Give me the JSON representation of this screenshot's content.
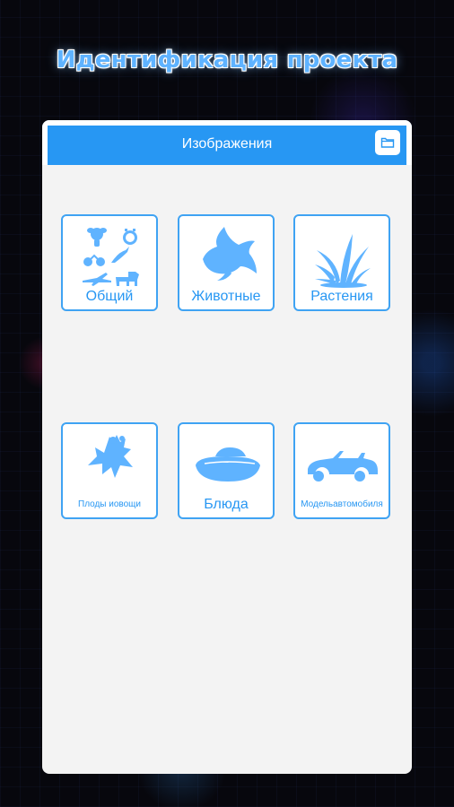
{
  "headline": "Идентификация проекта",
  "topbar": {
    "title": "Изображения",
    "folder_icon": "folder-icon"
  },
  "colors": {
    "accent": "#2797f3",
    "tile_border": "#3fa3f3",
    "panel_bg": "#f3f3f3"
  },
  "categories": [
    {
      "label": "Общий",
      "icon": "mixed-silhouettes-icon"
    },
    {
      "label": "Животные",
      "icon": "goldfish-icon"
    },
    {
      "label": "Растения",
      "icon": "grass-icon"
    },
    {
      "label": "Плоды иовощи",
      "icon": "fruit-icon"
    },
    {
      "label": "Блюда",
      "icon": "dish-icon"
    },
    {
      "label": "Модельавтомобиля",
      "icon": "convertible-car-icon"
    }
  ]
}
